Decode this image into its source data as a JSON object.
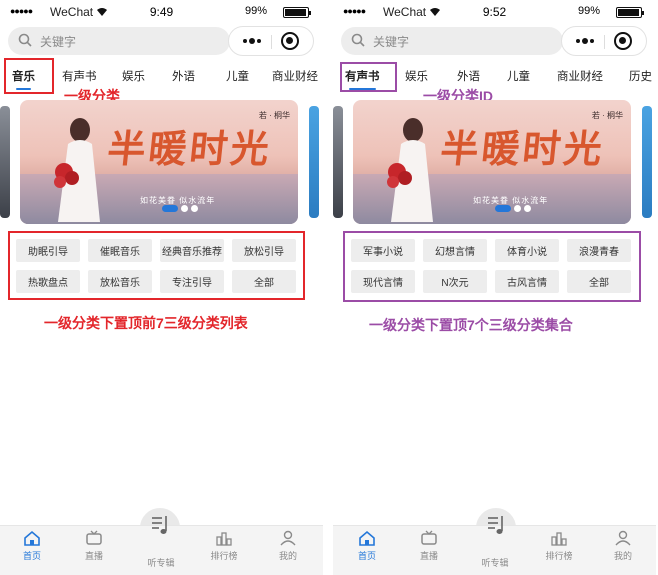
{
  "colors": {
    "accent": "#2477d9",
    "annotation_red": "#e3262b",
    "annotation_purple": "#9b4ca6",
    "chip_bg": "#ededed"
  },
  "status_bars": [
    {
      "carrier": "WeChat",
      "time": "9:49",
      "battery": "99%"
    },
    {
      "carrier": "WeChat",
      "time": "9:52",
      "battery": "99%"
    }
  ],
  "search": {
    "placeholder": "关键字",
    "icon": "search-icon"
  },
  "capsule": {
    "more_icon": "more-dots-icon",
    "close_icon": "target-circle-icon"
  },
  "left": {
    "tabs": [
      "音乐",
      "有声书",
      "娱乐",
      "外语",
      "儿童",
      "商业财经"
    ],
    "active_tab": "音乐",
    "banner": {
      "title": "半暖时光",
      "subtitle": "如花美眷 似水流年",
      "tag": "若 · 桐华"
    },
    "chips": [
      "助眠引导",
      "催眠音乐",
      "经典音乐推荐",
      "放松引导",
      "热歌盘点",
      "放松音乐",
      "专注引导",
      "全部"
    ],
    "annotations": {
      "tab_label": "一级分类",
      "grid_label": "一级分类下置顶前7三级分类列表"
    }
  },
  "right": {
    "tabs": [
      "有声书",
      "娱乐",
      "外语",
      "儿童",
      "商业财经",
      "历史"
    ],
    "active_tab": "有声书",
    "banner": {
      "title": "半暖时光",
      "subtitle": "如花美眷 似水流年",
      "tag": "若 · 桐华"
    },
    "chips": [
      "军事小说",
      "幻想言情",
      "体育小说",
      "浪漫青春",
      "现代言情",
      "N次元",
      "古风言情",
      "全部"
    ],
    "annotations": {
      "tab_label": "一级分类ID",
      "grid_label": "一级分类下置顶7个三级分类集合"
    }
  },
  "tabbar": {
    "items": [
      {
        "label": "首页",
        "icon": "home-icon"
      },
      {
        "label": "直播",
        "icon": "tv-icon"
      },
      {
        "label": "听专辑",
        "icon": "album-icon"
      },
      {
        "label": "排行榜",
        "icon": "ranking-icon"
      },
      {
        "label": "我的",
        "icon": "user-icon"
      }
    ],
    "active": "首页"
  }
}
